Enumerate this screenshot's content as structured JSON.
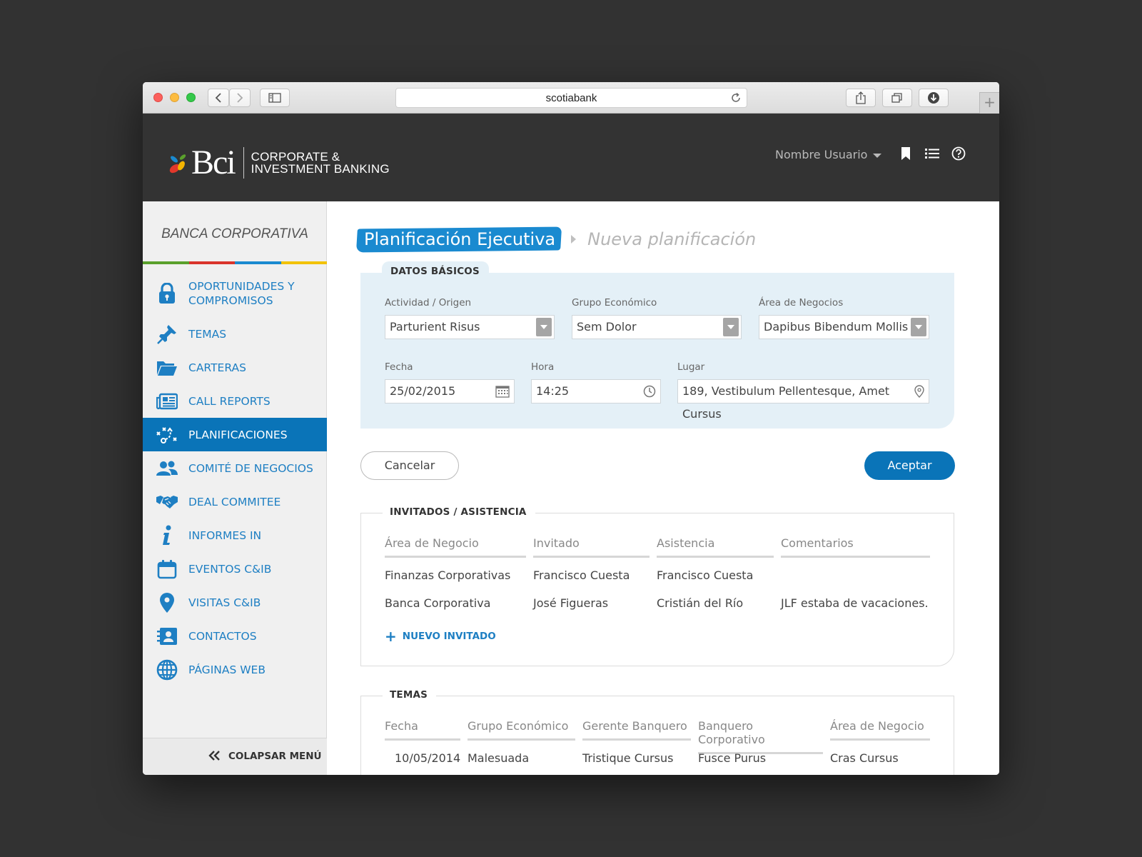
{
  "browser": {
    "url": "scotiabank"
  },
  "header": {
    "brand": "Bci",
    "brand_line1": "CORPORATE &",
    "brand_line2": "INVESTMENT BANKING",
    "user_name": "Nombre Usuario"
  },
  "sidebar": {
    "title": "BANCA CORPORATIVA",
    "items": [
      {
        "label": "OPORTUNIDADES Y",
        "label2": "COMPROMISOS",
        "icon": "lock-icon"
      },
      {
        "label": "TEMAS",
        "icon": "pushpin-icon"
      },
      {
        "label": "CARTERAS",
        "icon": "folder-icon"
      },
      {
        "label": "CALL REPORTS",
        "icon": "newspaper-icon"
      },
      {
        "label": "PLANIFICACIONES",
        "icon": "strategy-icon",
        "active": true
      },
      {
        "label": "COMITÉ DE NEGOCIOS",
        "icon": "users-icon"
      },
      {
        "label": "DEAL COMMITEE",
        "icon": "handshake-icon"
      },
      {
        "label": "INFORMES IN",
        "icon": "info-icon"
      },
      {
        "label": "EVENTOS C&IB",
        "icon": "calendar-icon"
      },
      {
        "label": "VISITAS C&IB",
        "icon": "map-pin-icon"
      },
      {
        "label": "CONTACTOS",
        "icon": "contact-card-icon"
      },
      {
        "label": "PÁGINAS WEB",
        "icon": "globe-icon"
      }
    ],
    "collapse_label": "COLAPSAR MENÚ"
  },
  "breadcrumb": {
    "current": "Planificación Ejecutiva",
    "sub": "Nueva planificación"
  },
  "basic": {
    "legend": "DATOS BÁSICOS",
    "actividad_label": "Actividad / Origen",
    "actividad_value": "Parturient Risus",
    "grupo_label": "Grupo Económico",
    "grupo_value": "Sem Dolor",
    "area_label": "Área de Negocios",
    "area_value": "Dapibus Bibendum Mollis",
    "fecha_label": "Fecha",
    "fecha_value": "25/02/2015",
    "hora_label": "Hora",
    "hora_value": "14:25",
    "lugar_label": "Lugar",
    "lugar_value": "189, Vestibulum Pellentesque, Amet Cursus"
  },
  "actions": {
    "cancel": "Cancelar",
    "accept": "Aceptar"
  },
  "invitados": {
    "legend": "INVITADOS / ASISTENCIA",
    "columns": [
      "Área de Negocio",
      "Invitado",
      "Asistencia",
      "Comentarios"
    ],
    "rows": [
      [
        "Finanzas Corporativas",
        "Francisco Cuesta",
        "Francisco Cuesta",
        ""
      ],
      [
        "Banca Corporativa",
        "José Figueras",
        "Cristián del Río",
        "JLF estaba de vacaciones."
      ]
    ],
    "add_label": "NUEVO INVITADO"
  },
  "temas": {
    "legend": "TEMAS",
    "columns": [
      "Fecha",
      "Grupo Económico",
      "Gerente Banquero",
      "Banquero Corporativo",
      "Área de Negocio"
    ],
    "rows": [
      [
        "10/05/2014",
        "Malesuada",
        "Tristique Cursus",
        "Fusce Purus",
        "Cras Cursus"
      ]
    ]
  },
  "colors": {
    "accent": "#0a74b8",
    "link": "#1e7fc3",
    "header_bg": "#333333",
    "rainbow": [
      "#5aa02c",
      "#d9342b",
      "#1a8ad0",
      "#f2c200"
    ]
  }
}
